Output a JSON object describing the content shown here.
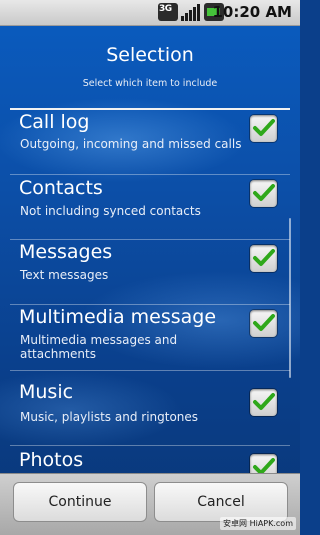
{
  "status_bar": {
    "network_label": "3G",
    "time": "10:20 AM"
  },
  "header": {
    "title": "Selection",
    "subtitle": "Select which item to include"
  },
  "items": [
    {
      "label": "Call log",
      "description": "Outgoing, incoming and missed calls",
      "checked": true
    },
    {
      "label": "Contacts",
      "description": "Not including synced contacts",
      "checked": true
    },
    {
      "label": "Messages",
      "description": "Text messages",
      "checked": true
    },
    {
      "label": "Multimedia message",
      "description": "Multimedia messages and attachments",
      "checked": true
    },
    {
      "label": "Music",
      "description": "Music, playlists and ringtones",
      "checked": true
    },
    {
      "label": "Photos",
      "description": "",
      "checked": true
    }
  ],
  "buttons": {
    "continue_label": "Continue",
    "cancel_label": "Cancel"
  },
  "watermark_text": "安卓网 HiAPK.com",
  "colors": {
    "checkmark": "#2fa81a",
    "background": "#0b4fa8"
  }
}
